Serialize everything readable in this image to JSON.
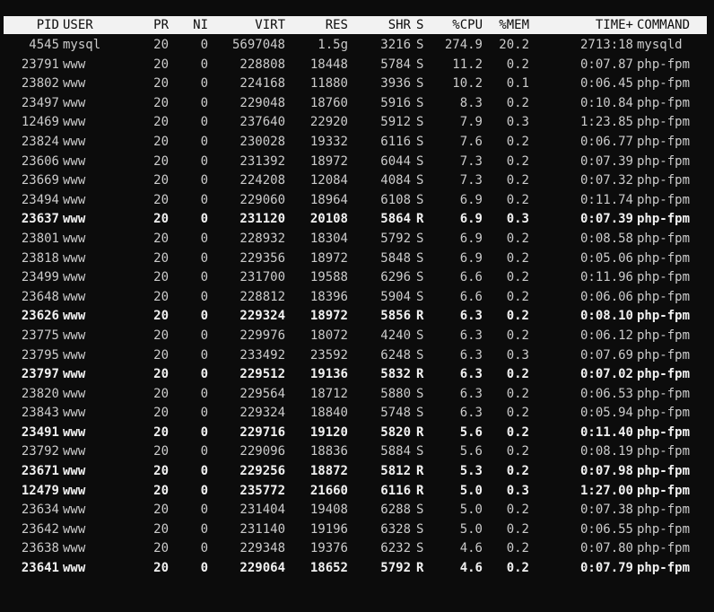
{
  "header": {
    "pid": "PID",
    "user": "USER",
    "pr": "PR",
    "ni": "NI",
    "virt": "VIRT",
    "res": "RES",
    "shr": "SHR",
    "s": "S",
    "cpu": "%CPU",
    "mem": "%MEM",
    "time": "TIME+",
    "command": "COMMAND"
  },
  "processes": [
    {
      "pid": "4545",
      "user": "mysql",
      "pr": "20",
      "ni": "0",
      "virt": "5697048",
      "res": "1.5g",
      "shr": "3216",
      "s": "S",
      "cpu": "274.9",
      "mem": "20.2",
      "time": "2713:18",
      "command": "mysqld",
      "bold": false
    },
    {
      "pid": "23791",
      "user": "www",
      "pr": "20",
      "ni": "0",
      "virt": "228808",
      "res": "18448",
      "shr": "5784",
      "s": "S",
      "cpu": "11.2",
      "mem": "0.2",
      "time": "0:07.87",
      "command": "php-fpm",
      "bold": false
    },
    {
      "pid": "23802",
      "user": "www",
      "pr": "20",
      "ni": "0",
      "virt": "224168",
      "res": "11880",
      "shr": "3936",
      "s": "S",
      "cpu": "10.2",
      "mem": "0.1",
      "time": "0:06.45",
      "command": "php-fpm",
      "bold": false
    },
    {
      "pid": "23497",
      "user": "www",
      "pr": "20",
      "ni": "0",
      "virt": "229048",
      "res": "18760",
      "shr": "5916",
      "s": "S",
      "cpu": "8.3",
      "mem": "0.2",
      "time": "0:10.84",
      "command": "php-fpm",
      "bold": false
    },
    {
      "pid": "12469",
      "user": "www",
      "pr": "20",
      "ni": "0",
      "virt": "237640",
      "res": "22920",
      "shr": "5912",
      "s": "S",
      "cpu": "7.9",
      "mem": "0.3",
      "time": "1:23.85",
      "command": "php-fpm",
      "bold": false
    },
    {
      "pid": "23824",
      "user": "www",
      "pr": "20",
      "ni": "0",
      "virt": "230028",
      "res": "19332",
      "shr": "6116",
      "s": "S",
      "cpu": "7.6",
      "mem": "0.2",
      "time": "0:06.77",
      "command": "php-fpm",
      "bold": false
    },
    {
      "pid": "23606",
      "user": "www",
      "pr": "20",
      "ni": "0",
      "virt": "231392",
      "res": "18972",
      "shr": "6044",
      "s": "S",
      "cpu": "7.3",
      "mem": "0.2",
      "time": "0:07.39",
      "command": "php-fpm",
      "bold": false
    },
    {
      "pid": "23669",
      "user": "www",
      "pr": "20",
      "ni": "0",
      "virt": "224208",
      "res": "12084",
      "shr": "4084",
      "s": "S",
      "cpu": "7.3",
      "mem": "0.2",
      "time": "0:07.32",
      "command": "php-fpm",
      "bold": false
    },
    {
      "pid": "23494",
      "user": "www",
      "pr": "20",
      "ni": "0",
      "virt": "229060",
      "res": "18964",
      "shr": "6108",
      "s": "S",
      "cpu": "6.9",
      "mem": "0.2",
      "time": "0:11.74",
      "command": "php-fpm",
      "bold": false
    },
    {
      "pid": "23637",
      "user": "www",
      "pr": "20",
      "ni": "0",
      "virt": "231120",
      "res": "20108",
      "shr": "5864",
      "s": "R",
      "cpu": "6.9",
      "mem": "0.3",
      "time": "0:07.39",
      "command": "php-fpm",
      "bold": true
    },
    {
      "pid": "23801",
      "user": "www",
      "pr": "20",
      "ni": "0",
      "virt": "228932",
      "res": "18304",
      "shr": "5792",
      "s": "S",
      "cpu": "6.9",
      "mem": "0.2",
      "time": "0:08.58",
      "command": "php-fpm",
      "bold": false
    },
    {
      "pid": "23818",
      "user": "www",
      "pr": "20",
      "ni": "0",
      "virt": "229356",
      "res": "18972",
      "shr": "5848",
      "s": "S",
      "cpu": "6.9",
      "mem": "0.2",
      "time": "0:05.06",
      "command": "php-fpm",
      "bold": false
    },
    {
      "pid": "23499",
      "user": "www",
      "pr": "20",
      "ni": "0",
      "virt": "231700",
      "res": "19588",
      "shr": "6296",
      "s": "S",
      "cpu": "6.6",
      "mem": "0.2",
      "time": "0:11.96",
      "command": "php-fpm",
      "bold": false
    },
    {
      "pid": "23648",
      "user": "www",
      "pr": "20",
      "ni": "0",
      "virt": "228812",
      "res": "18396",
      "shr": "5904",
      "s": "S",
      "cpu": "6.6",
      "mem": "0.2",
      "time": "0:06.06",
      "command": "php-fpm",
      "bold": false
    },
    {
      "pid": "23626",
      "user": "www",
      "pr": "20",
      "ni": "0",
      "virt": "229324",
      "res": "18972",
      "shr": "5856",
      "s": "R",
      "cpu": "6.3",
      "mem": "0.2",
      "time": "0:08.10",
      "command": "php-fpm",
      "bold": true
    },
    {
      "pid": "23775",
      "user": "www",
      "pr": "20",
      "ni": "0",
      "virt": "229976",
      "res": "18072",
      "shr": "4240",
      "s": "S",
      "cpu": "6.3",
      "mem": "0.2",
      "time": "0:06.12",
      "command": "php-fpm",
      "bold": false
    },
    {
      "pid": "23795",
      "user": "www",
      "pr": "20",
      "ni": "0",
      "virt": "233492",
      "res": "23592",
      "shr": "6248",
      "s": "S",
      "cpu": "6.3",
      "mem": "0.3",
      "time": "0:07.69",
      "command": "php-fpm",
      "bold": false
    },
    {
      "pid": "23797",
      "user": "www",
      "pr": "20",
      "ni": "0",
      "virt": "229512",
      "res": "19136",
      "shr": "5832",
      "s": "R",
      "cpu": "6.3",
      "mem": "0.2",
      "time": "0:07.02",
      "command": "php-fpm",
      "bold": true
    },
    {
      "pid": "23820",
      "user": "www",
      "pr": "20",
      "ni": "0",
      "virt": "229564",
      "res": "18712",
      "shr": "5880",
      "s": "S",
      "cpu": "6.3",
      "mem": "0.2",
      "time": "0:06.53",
      "command": "php-fpm",
      "bold": false
    },
    {
      "pid": "23843",
      "user": "www",
      "pr": "20",
      "ni": "0",
      "virt": "229324",
      "res": "18840",
      "shr": "5748",
      "s": "S",
      "cpu": "6.3",
      "mem": "0.2",
      "time": "0:05.94",
      "command": "php-fpm",
      "bold": false
    },
    {
      "pid": "23491",
      "user": "www",
      "pr": "20",
      "ni": "0",
      "virt": "229716",
      "res": "19120",
      "shr": "5820",
      "s": "R",
      "cpu": "5.6",
      "mem": "0.2",
      "time": "0:11.40",
      "command": "php-fpm",
      "bold": true
    },
    {
      "pid": "23792",
      "user": "www",
      "pr": "20",
      "ni": "0",
      "virt": "229096",
      "res": "18836",
      "shr": "5884",
      "s": "S",
      "cpu": "5.6",
      "mem": "0.2",
      "time": "0:08.19",
      "command": "php-fpm",
      "bold": false
    },
    {
      "pid": "23671",
      "user": "www",
      "pr": "20",
      "ni": "0",
      "virt": "229256",
      "res": "18872",
      "shr": "5812",
      "s": "R",
      "cpu": "5.3",
      "mem": "0.2",
      "time": "0:07.98",
      "command": "php-fpm",
      "bold": true
    },
    {
      "pid": "12479",
      "user": "www",
      "pr": "20",
      "ni": "0",
      "virt": "235772",
      "res": "21660",
      "shr": "6116",
      "s": "R",
      "cpu": "5.0",
      "mem": "0.3",
      "time": "1:27.00",
      "command": "php-fpm",
      "bold": true
    },
    {
      "pid": "23634",
      "user": "www",
      "pr": "20",
      "ni": "0",
      "virt": "231404",
      "res": "19408",
      "shr": "6288",
      "s": "S",
      "cpu": "5.0",
      "mem": "0.2",
      "time": "0:07.38",
      "command": "php-fpm",
      "bold": false
    },
    {
      "pid": "23642",
      "user": "www",
      "pr": "20",
      "ni": "0",
      "virt": "231140",
      "res": "19196",
      "shr": "6328",
      "s": "S",
      "cpu": "5.0",
      "mem": "0.2",
      "time": "0:06.55",
      "command": "php-fpm",
      "bold": false
    },
    {
      "pid": "23638",
      "user": "www",
      "pr": "20",
      "ni": "0",
      "virt": "229348",
      "res": "19376",
      "shr": "6232",
      "s": "S",
      "cpu": "4.6",
      "mem": "0.2",
      "time": "0:07.80",
      "command": "php-fpm",
      "bold": false
    },
    {
      "pid": "23641",
      "user": "www",
      "pr": "20",
      "ni": "0",
      "virt": "229064",
      "res": "18652",
      "shr": "5792",
      "s": "R",
      "cpu": "4.6",
      "mem": "0.2",
      "time": "0:07.79",
      "command": "php-fpm",
      "bold": true
    }
  ],
  "colors": {
    "background": "#0c0c0c",
    "text": "#cccccc",
    "bold_text": "#f2f2f2",
    "header_background": "#f2f2f2",
    "header_text": "#0c0c0c"
  }
}
